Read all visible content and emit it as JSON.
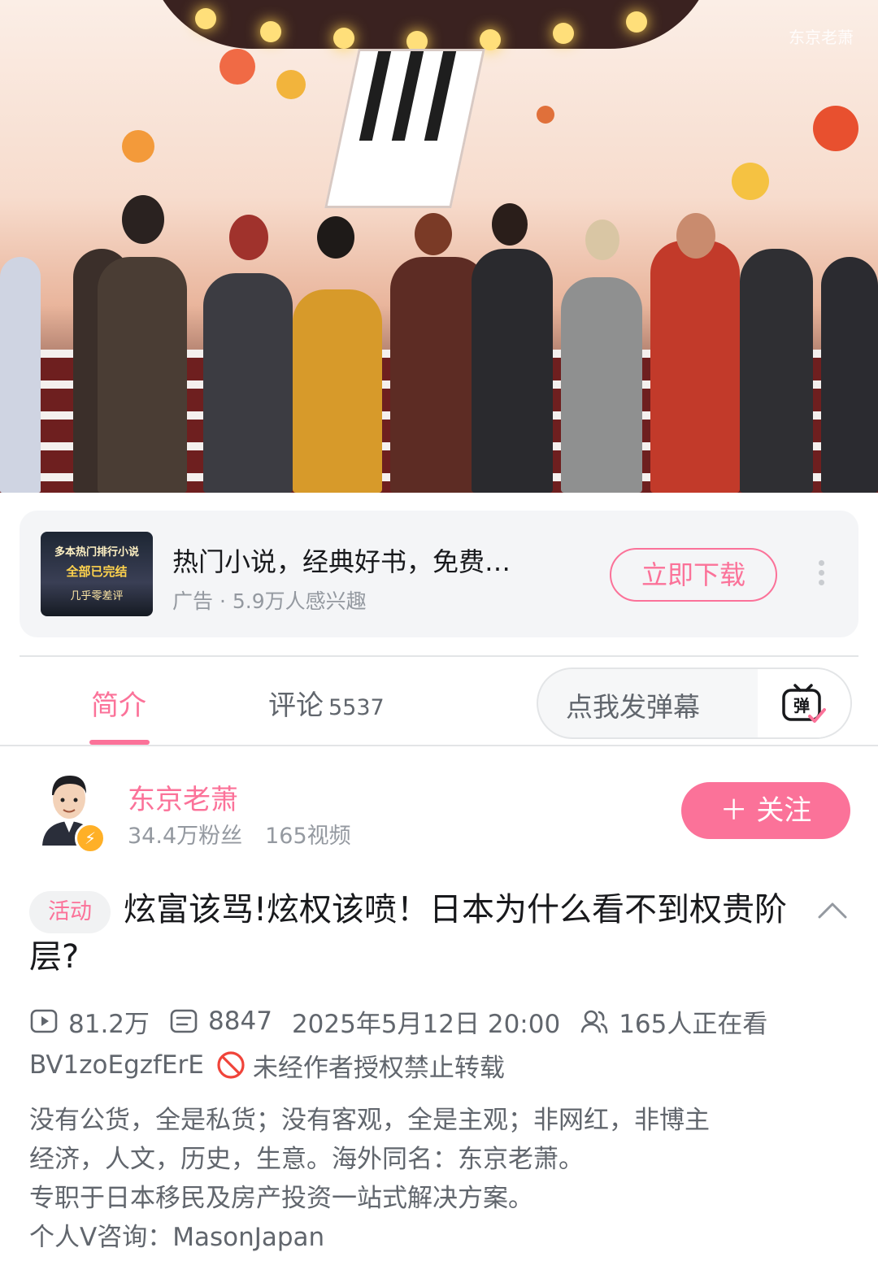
{
  "video": {
    "watermark": "东京老萧"
  },
  "ad": {
    "thumb_line1": "多本热门排行小说",
    "thumb_line2": "全部已完结",
    "thumb_line3": "几乎零差评",
    "title": "热门小说，经典好书，免费…",
    "subtitle": "广告 · 5.9万人感兴趣",
    "download_label": "立即下载",
    "more_icon": "more-vertical-icon"
  },
  "tabs": {
    "intro_label": "简介",
    "comments_label": "评论",
    "comments_count": "5537",
    "danmaku_placeholder": "点我发弹幕",
    "danmaku_icon": "danmaku-toggle-icon"
  },
  "uploader": {
    "name": "东京老萧",
    "fans": "34.4万粉丝",
    "videos": "165视频",
    "follow_label": "＋ 关注",
    "verified_icon": "lightning-verified-icon"
  },
  "video_info": {
    "tag": "活动",
    "title": "炫富该骂!炫权该喷！日本为什么看不到权贵阶层?",
    "views": "81.2万",
    "danmaku_count": "8847",
    "datetime": "2025年5月12日 20:00",
    "watching": "165人正在看",
    "bvid": "BV1zoEgzfErE",
    "repost_notice": "未经作者授权禁止转载",
    "description": [
      "没有公货，全是私货；没有客观，全是主观；非网红，非博主",
      "经济，人文，历史，生意。海外同名：东京老萧。",
      "专职于日本移民及房产投资一站式解决方案。",
      "个人V咨询：MasonJapan"
    ]
  },
  "colors": {
    "accent": "#fb7299",
    "text_primary": "#18191c",
    "text_secondary": "#61666d",
    "text_tertiary": "#9499a0",
    "verified": "#ffb027"
  }
}
